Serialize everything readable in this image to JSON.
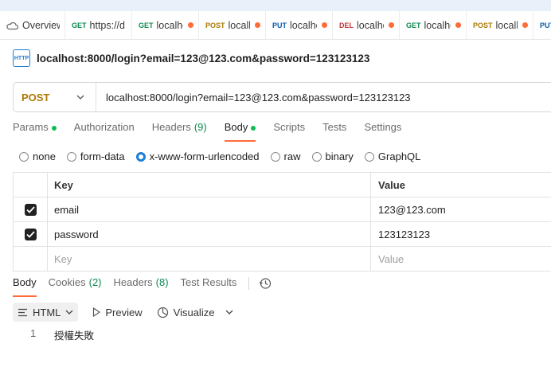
{
  "tabs": [
    {
      "method": "",
      "label": "Overview"
    },
    {
      "method": "GET",
      "label": "https://d"
    },
    {
      "method": "GET",
      "label": "localhos"
    },
    {
      "method": "POST",
      "label": "localhc"
    },
    {
      "method": "PUT",
      "label": "localhos"
    },
    {
      "method": "DEL",
      "label": "localhos"
    },
    {
      "method": "GET",
      "label": "localhos"
    },
    {
      "method": "POST",
      "label": "localhc"
    },
    {
      "method": "PUT",
      "label": ""
    }
  ],
  "request": {
    "icon_label": "HTTP",
    "name": "localhost:8000/login?email=123@123.com&password=123123123",
    "method": "POST",
    "url": "localhost:8000/login?email=123@123.com&password=123123123"
  },
  "request_tabs": [
    {
      "label": "Params",
      "count": ""
    },
    {
      "label": "Authorization",
      "count": ""
    },
    {
      "label": "Headers",
      "count": "(9)"
    },
    {
      "label": "Body",
      "count": ""
    },
    {
      "label": "Scripts",
      "count": ""
    },
    {
      "label": "Tests",
      "count": ""
    },
    {
      "label": "Settings",
      "count": ""
    }
  ],
  "body_types": [
    "none",
    "form-data",
    "x-www-form-urlencoded",
    "raw",
    "binary",
    "GraphQL"
  ],
  "table": {
    "key_header": "Key",
    "value_header": "Value",
    "rows": [
      {
        "key": "email",
        "value": "123@123.com"
      },
      {
        "key": "password",
        "value": "123123123"
      }
    ],
    "key_placeholder": "Key",
    "value_placeholder": "Value"
  },
  "response_tabs": [
    {
      "label": "Body",
      "count": ""
    },
    {
      "label": "Cookies",
      "count": "(2)"
    },
    {
      "label": "Headers",
      "count": "(8)"
    },
    {
      "label": "Test Results",
      "count": ""
    }
  ],
  "response_toolbar": {
    "format": "HTML",
    "preview": "Preview",
    "visualize": "Visualize"
  },
  "response_body": {
    "line_number": "1",
    "text": "授權失敗"
  },
  "colors": {
    "accent": "#ff6c37",
    "get": "#0f8a4f",
    "post": "#ad7a03",
    "put": "#0b5cad",
    "delete": "#c43434",
    "selected_radio": "#1c7ed6"
  }
}
